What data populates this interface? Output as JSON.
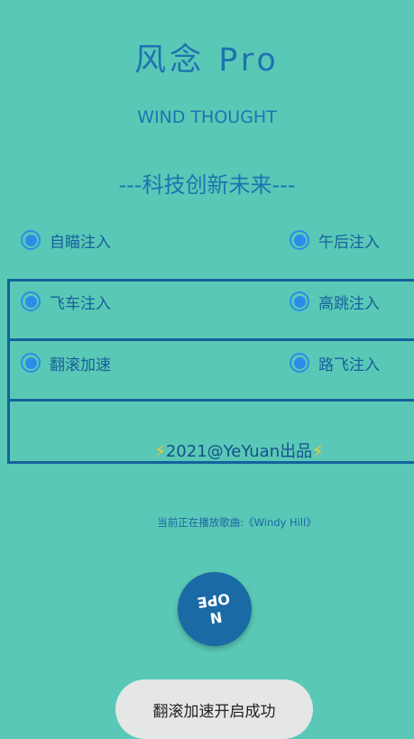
{
  "header": {
    "title": "风念 Pro",
    "subtitle": "WIND THOUGHT",
    "slogan": "---科技创新未来---"
  },
  "options": [
    {
      "label": "自瞄注入",
      "selected": true
    },
    {
      "label": "午后注入",
      "selected": true
    },
    {
      "label": "飞车注入",
      "selected": true
    },
    {
      "label": "高跳注入",
      "selected": true
    },
    {
      "label": "翻滚加速",
      "selected": true
    },
    {
      "label": "路飞注入",
      "selected": true
    }
  ],
  "footer": {
    "credit": "2021@YeYuan出品",
    "bolt_glyph": "⚡",
    "now_playing": "当前正在播放歌曲:《Windy Hill》"
  },
  "fab": {
    "line1": "N",
    "line2": "OPE"
  },
  "toast": {
    "message": "翻滚加速开启成功"
  },
  "colors": {
    "background": "#5ac8b6",
    "accent": "#1e73b0",
    "radio": "#2a8ee8",
    "frame": "#14629c",
    "fab": "#1a6aa6",
    "toast": "#e4e7e6"
  }
}
